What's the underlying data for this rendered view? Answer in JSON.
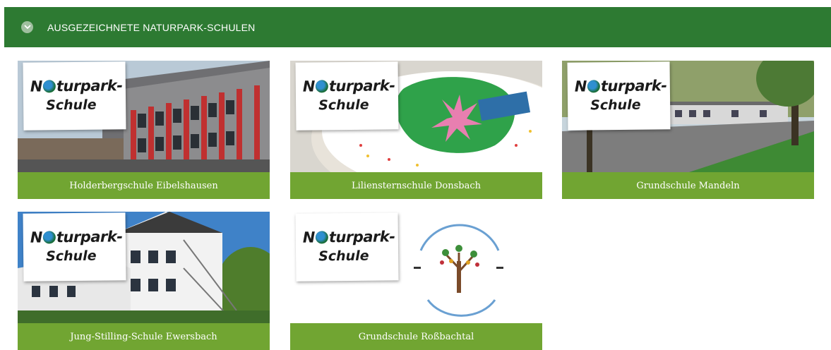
{
  "header": {
    "title": "AUSGEZEICHNETE NATURPARK-SCHULEN"
  },
  "logo": {
    "line1_a": "N",
    "line1_b": "turpark-",
    "line2": "Schule"
  },
  "schools": [
    {
      "name": "Holderbergschule Eibelshausen"
    },
    {
      "name": "Liliensternschule Donsbach"
    },
    {
      "name": "Grundschule Mandeln"
    },
    {
      "name": "Jung-Stilling-Schule Ewersbach"
    },
    {
      "name": "Grundschule Roßbachtal"
    }
  ],
  "colors": {
    "header": "#2d7a32",
    "caption": "#71a532"
  }
}
